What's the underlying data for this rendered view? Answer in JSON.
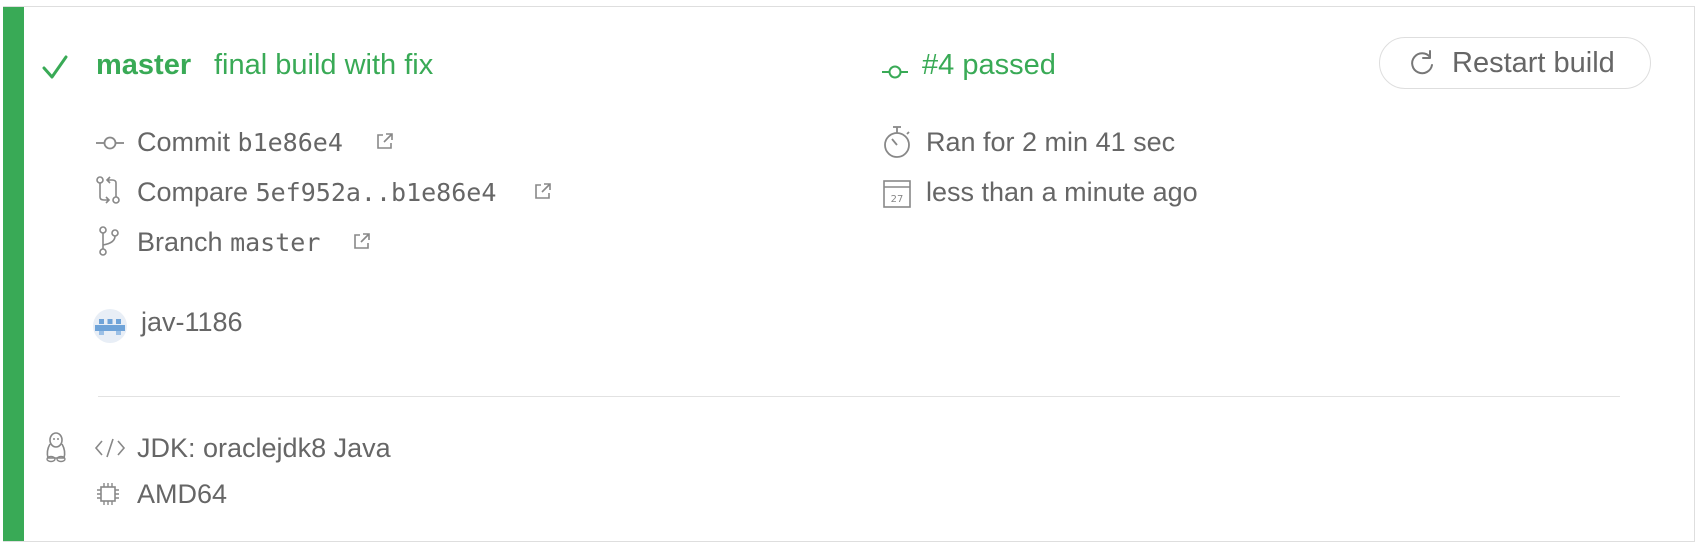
{
  "build": {
    "branch": "master",
    "commit_message": "final build with fix",
    "build_status": "#4 passed",
    "status_color": "#39aa56",
    "restart_label": "Restart build"
  },
  "details": {
    "commit_label": "Commit",
    "commit_sha": "b1e86e4",
    "compare_label": "Compare",
    "compare_range": "5ef952a..b1e86e4",
    "branch_label": "Branch",
    "branch_value": "master",
    "author": "jav-1186"
  },
  "timing": {
    "duration": "Ran for 2 min 41 sec",
    "finished": "less than a minute ago",
    "calendar_day": "27"
  },
  "environment": {
    "jdk": "JDK: oraclejdk8 Java",
    "arch": "AMD64"
  },
  "icons": [
    "check-icon",
    "commit-icon",
    "compare-icon",
    "branch-icon",
    "external-link-icon",
    "stopwatch-icon",
    "calendar-icon",
    "restart-icon",
    "linux-icon",
    "code-icon",
    "cpu-icon",
    "avatar"
  ]
}
